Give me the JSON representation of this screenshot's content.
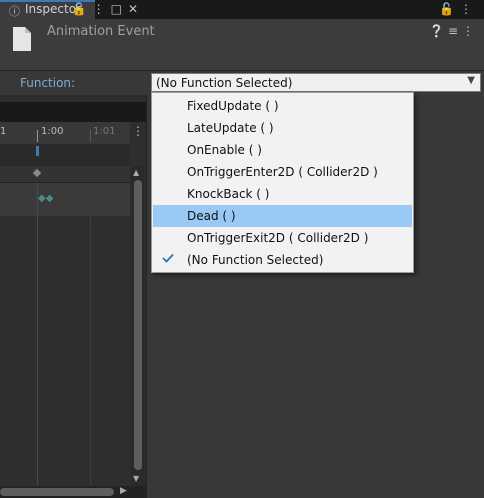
{
  "tab": {
    "label": "Inspector",
    "icon": "info-icon",
    "right_icons": [
      "lock-icon",
      "kebab-menu-icon"
    ]
  },
  "header": {
    "title": "Animation Event",
    "icon": "document-icon",
    "icons": [
      "help-icon",
      "sliders-icon",
      "kebab-menu-icon"
    ]
  },
  "function": {
    "label": "Function:",
    "selected": "(No Function Selected)"
  },
  "dropdown": {
    "items": [
      {
        "label": "FixedUpdate ( )",
        "highlighted": false,
        "checked": false
      },
      {
        "label": "LateUpdate ( )",
        "highlighted": false,
        "checked": false
      },
      {
        "label": "OnEnable ( )",
        "highlighted": false,
        "checked": false
      },
      {
        "label": "OnTriggerEnter2D ( Collider2D )",
        "highlighted": false,
        "checked": false
      },
      {
        "label": "KnockBack ( )",
        "highlighted": false,
        "checked": false
      },
      {
        "label": "Dead ( )",
        "highlighted": true,
        "checked": false
      },
      {
        "label": "OnTriggerExit2D ( Collider2D )",
        "highlighted": false,
        "checked": false
      },
      {
        "label": "(No Function Selected)",
        "highlighted": false,
        "checked": true
      }
    ]
  },
  "animation": {
    "time_labels": [
      "1",
      "1:00",
      "1:01"
    ],
    "topbar_icons": [
      "lock-icon",
      "kebab-menu-icon",
      "maximize-icon",
      "close-icon"
    ]
  },
  "colors": {
    "accent": "#3a79bb",
    "highlight": "#99c9f4",
    "label_blue": "#7cabd8"
  }
}
